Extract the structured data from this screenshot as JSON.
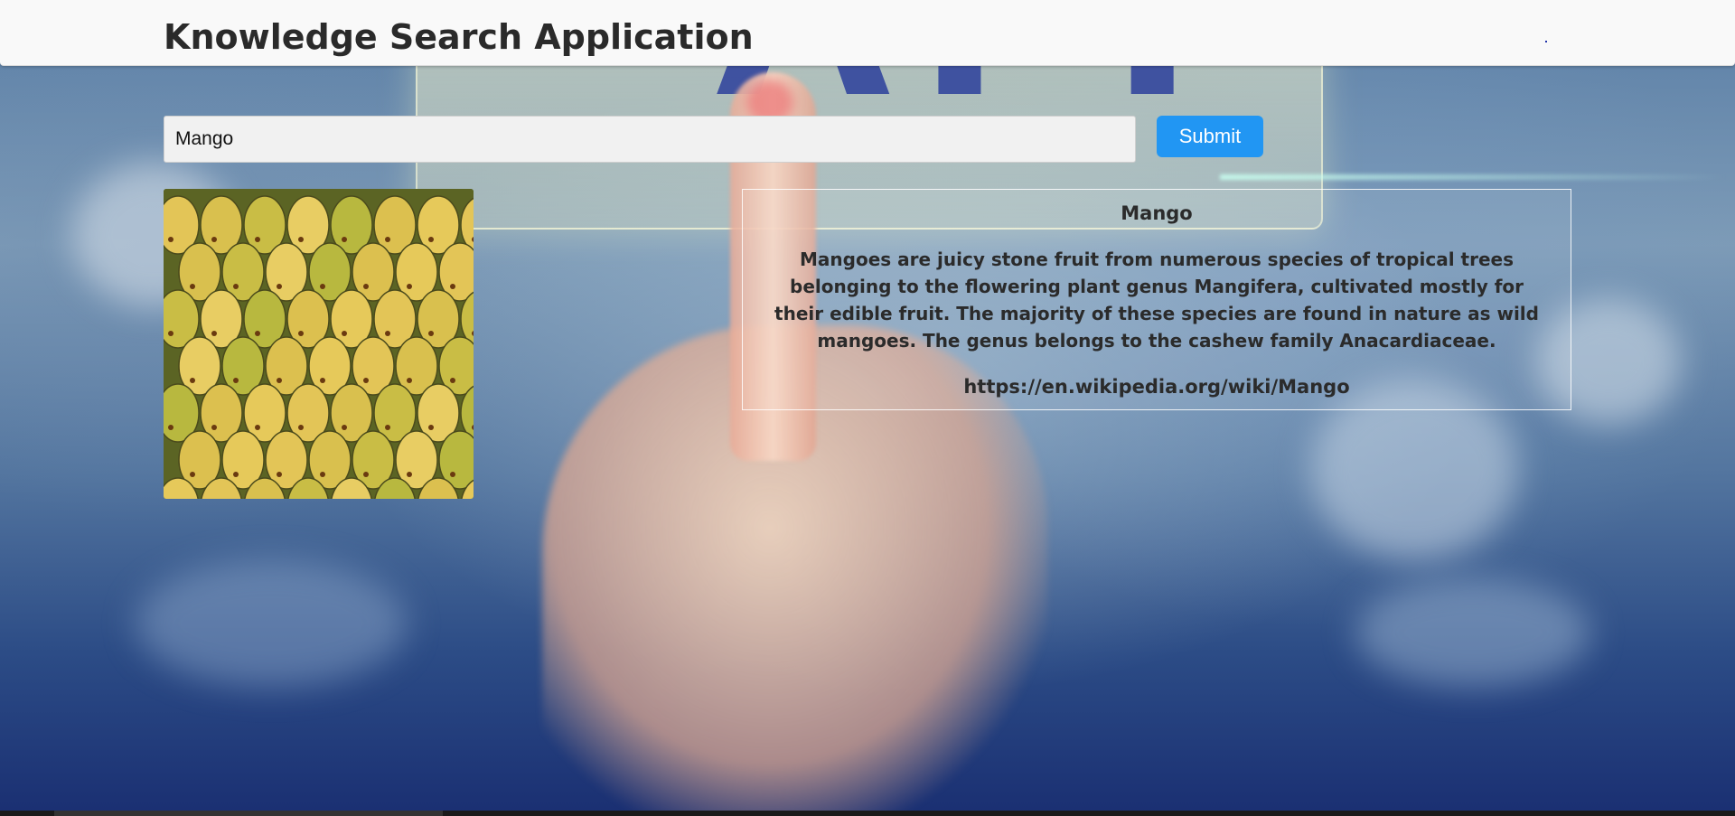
{
  "header": {
    "title": "Knowledge Search Application"
  },
  "search": {
    "value": "Mango",
    "submit_label": "Submit"
  },
  "result": {
    "title": "Mango",
    "description": "Mangoes are juicy stone fruit from numerous species of tropical trees belonging to the flowering plant genus Mangifera, cultivated mostly for their edible fruit. The majority of these species are found in nature as wild mangoes. The genus belongs to the cashew family Anacardiaceae.",
    "link": "https://en.wikipedia.org/wiki/Mango",
    "image_subject": "mangoes-photo"
  },
  "colors": {
    "submit": "#2196f3",
    "header_bg": "#f9f9f9",
    "text": "#2b2b2b"
  }
}
